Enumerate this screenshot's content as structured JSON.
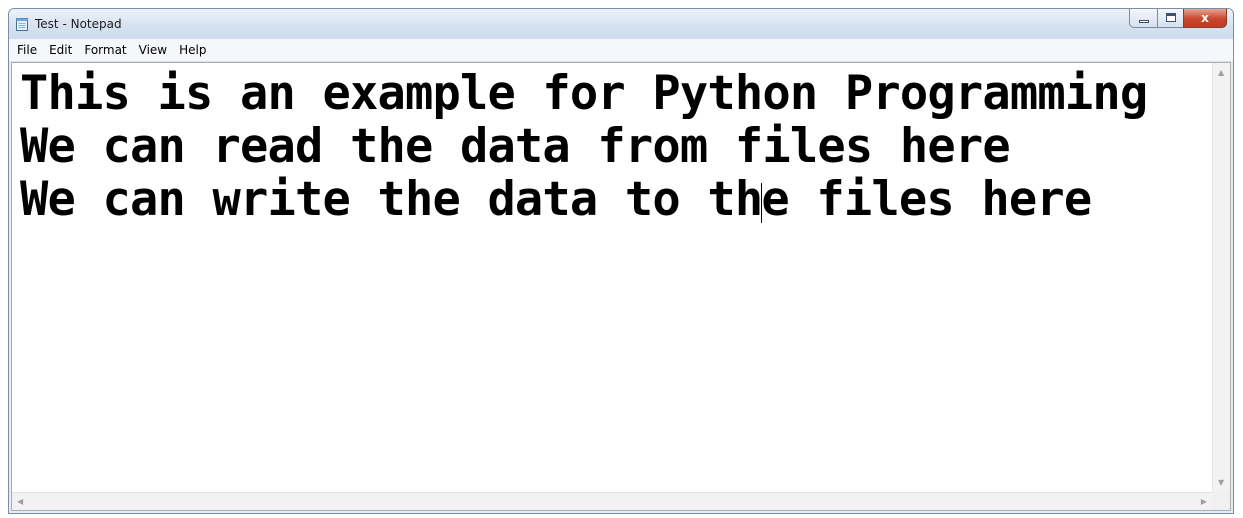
{
  "window": {
    "title": "Test - Notepad",
    "icon": "notepad-icon"
  },
  "menu": {
    "items": [
      "File",
      "Edit",
      "Format",
      "View",
      "Help"
    ]
  },
  "editor": {
    "lines": [
      "This is an example for Python Programming",
      "We can read the data from files here",
      "We can write the data to the files here"
    ]
  },
  "scrollbars": {
    "up_arrow": "▲",
    "down_arrow": "▼",
    "left_arrow": "◀",
    "right_arrow": "▶"
  },
  "colors": {
    "close_button": "#c8452d",
    "titlebar": "#d6e2f1"
  }
}
